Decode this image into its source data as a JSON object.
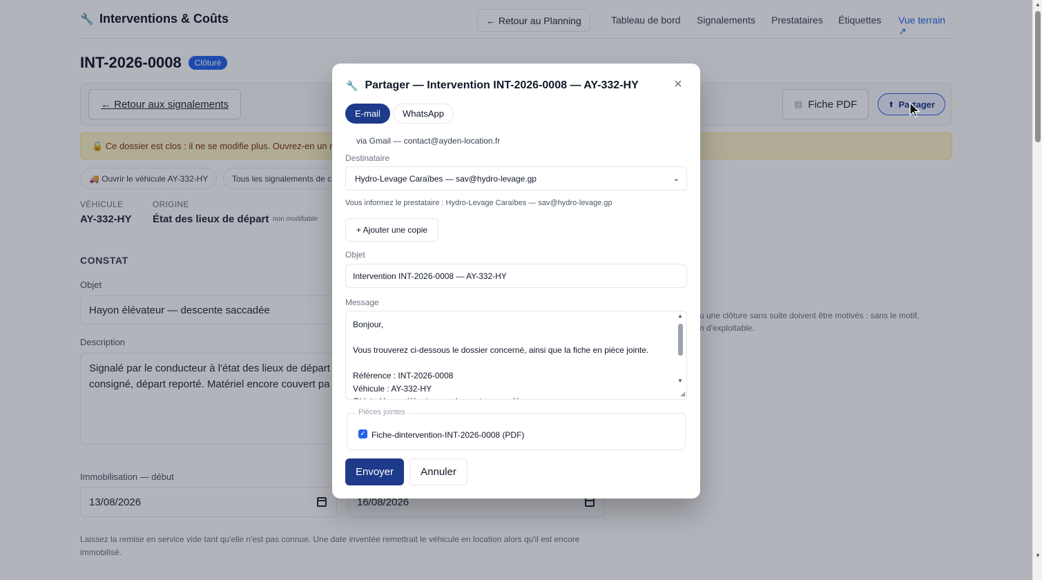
{
  "header": {
    "brand_icon": "wrench-icon",
    "brand": "Interventions & Coûts",
    "back_planning": "← Retour au Planning",
    "nav": [
      "Tableau de bord",
      "Signalements",
      "Prestataires",
      "Étiquettes",
      "Vue terrain ↗"
    ]
  },
  "page": {
    "title": "INT-2026-0008",
    "status_badge": "Clôturé",
    "back_reports": "← Retour aux signalements",
    "pdf_button": "Fiche PDF",
    "share_button": "Partager",
    "notice": "🔒 Ce dossier est clos : il ne se modifie plus. Ouvrez-en un no",
    "chips": [
      "🚚 Ouvrir le véhicule AY-332-HY",
      "Tous les signalements de c"
    ],
    "vehicle_label": "VÉHICULE",
    "vehicle_value": "AY-332-HY",
    "origin_label": "ORIGINE",
    "origin_value": "État des lieux de départ",
    "origin_hint": "non modifiable",
    "section_constat": "CONSTAT",
    "objet_label": "Objet",
    "objet_value": "Hayon élévateur — descente saccadée",
    "description_label": "Description",
    "description_value": "Signalé par le conducteur à l'état des lieux de départ\nconsigné, départ reporté. Matériel encore couvert pa",
    "side_note": "u une clôture sans suite doivent être motivés : sans le motif,\nn d'exploitable.",
    "immob_label": "Immobilisation — début",
    "immob_start": "13/08/2026",
    "immob_end": "16/08/2026",
    "foot_note": "Laissez la remise en service vide tant qu'elle n'est pas connue. Une date inventée remettrait le véhicule en location alors qu'il est encore immobilisé."
  },
  "modal": {
    "title": "Partager — Intervention INT-2026-0008 — AY-332-HY",
    "close": "×",
    "tab_email": "E-mail",
    "tab_whatsapp": "WhatsApp",
    "via": "via Gmail — contact@ayden-location.fr",
    "recipient_label": "Destinataire",
    "recipient_value": "Hydro-Levage Caraïbes — sav@hydro-levage.gp",
    "recipient_info": "Vous informez le prestataire : Hydro-Levage Caraïbes — sav@hydro-levage.gp",
    "add_copy": "+ Ajouter une copie",
    "subject_label": "Objet",
    "subject_value": "Intervention INT-2026-0008 — AY-332-HY",
    "message_label": "Message",
    "message_value": "Bonjour,\n\nVous trouverez ci-dessous le dossier concerné, ainsi que la fiche en pièce jointe.\n\nRéférence : INT-2026-0008\nVéhicule : AY-332-HY\nObjet : Hayon élévateur — descente saccadée",
    "attachments_legend": "Pièces jointes",
    "attachment_name": "Fiche-dintervention-INT-2026-0008 (PDF)",
    "attachment_checked": true,
    "send": "Envoyer",
    "cancel": "Annuler"
  }
}
